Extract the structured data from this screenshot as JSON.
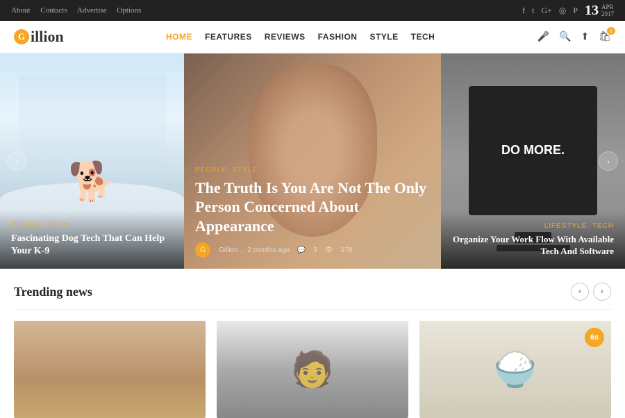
{
  "topbar": {
    "links": [
      "About",
      "Contacts",
      "Advertise",
      "Options"
    ],
    "socials": [
      "f",
      "t",
      "G+",
      "📷",
      "📌"
    ],
    "date": {
      "day": "13",
      "month": "APR",
      "year": "2017"
    }
  },
  "header": {
    "logo_letter": "G",
    "logo_text": "illion",
    "nav_items": [
      {
        "label": "HOME",
        "active": true
      },
      {
        "label": "FEATURES"
      },
      {
        "label": "REVIEWS"
      },
      {
        "label": "FASHION"
      },
      {
        "label": "STYLE"
      },
      {
        "label": "TECH"
      }
    ],
    "cart_count": "0"
  },
  "hero": {
    "left": {
      "categories": "DESIGN, TECH",
      "title": "Fascinating Dog Tech That Can Help Your K-9"
    },
    "center": {
      "categories": "PEOPLE, STYLE",
      "title": "The Truth Is You Are Not The Only Person Concerned About Appearance",
      "author": "Gillion",
      "time": "2 months ago",
      "comments": "3",
      "views": "178"
    },
    "right": {
      "categories": "LIFESTYLE, TECH",
      "title": "Organize Your Work Flow With Available Tech And Software",
      "do_more": "DO MORE."
    }
  },
  "trending": {
    "title": "Trending news",
    "badge": "6s",
    "cards": [
      {
        "type": "woman"
      },
      {
        "type": "man"
      },
      {
        "type": "food",
        "badge": "6s"
      }
    ]
  }
}
